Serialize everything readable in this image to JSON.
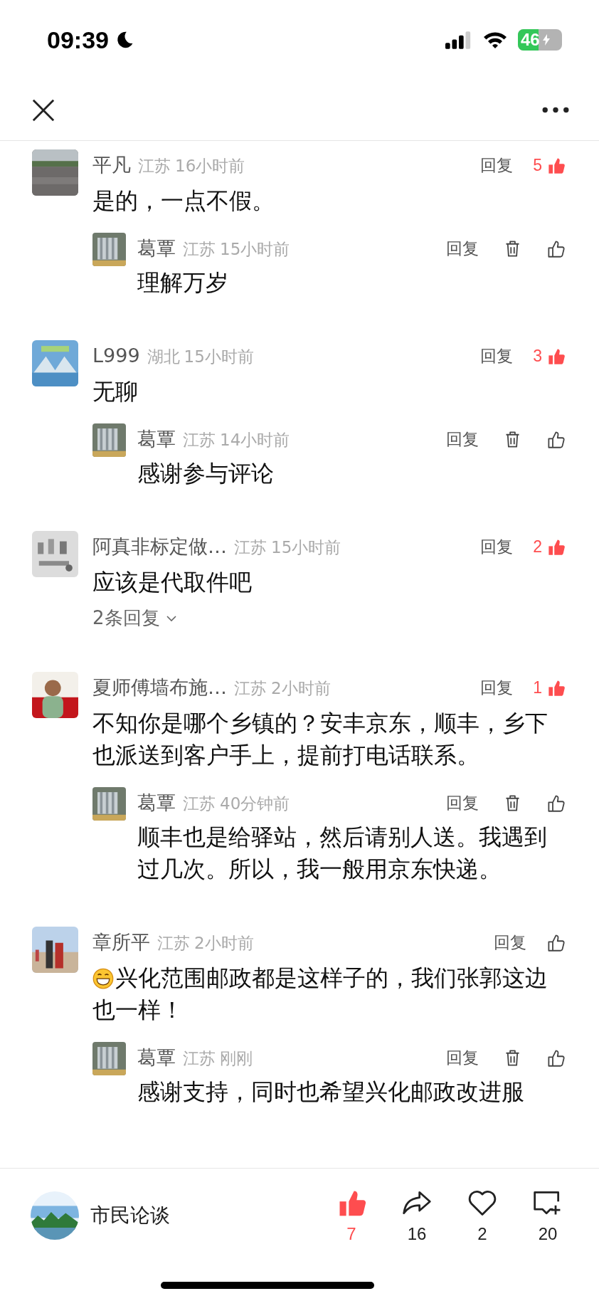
{
  "status_bar": {
    "time": "09:39",
    "battery": "46"
  },
  "comments": [
    {
      "name": "平凡",
      "region": "江苏",
      "time": "16小时前",
      "reply_label": "回复",
      "likes": "5",
      "liked": true,
      "text": "是的，一点不假。",
      "replies": [
        {
          "name": "葛覃",
          "region": "江苏",
          "time": "15小时前",
          "reply_label": "回复",
          "deletable": true,
          "liked": false,
          "text": "理解万岁"
        }
      ]
    },
    {
      "name": "L999",
      "region": "湖北",
      "time": "15小时前",
      "reply_label": "回复",
      "likes": "3",
      "liked": true,
      "text": "无聊",
      "replies": [
        {
          "name": "葛覃",
          "region": "江苏",
          "time": "14小时前",
          "reply_label": "回复",
          "deletable": true,
          "liked": false,
          "text": "感谢参与评论"
        }
      ]
    },
    {
      "name": "阿真非标定做…",
      "region": "江苏",
      "time": "15小时前",
      "reply_label": "回复",
      "likes": "2",
      "liked": true,
      "text": "应该是代取件吧",
      "more_replies": "2条回复"
    },
    {
      "name": "夏师傅墙布施…",
      "region": "江苏",
      "time": "2小时前",
      "reply_label": "回复",
      "likes": "1",
      "liked": true,
      "text": "不知你是哪个乡镇的？安丰京东，顺丰，乡下也派送到客户手上，提前打电话联系。",
      "replies": [
        {
          "name": "葛覃",
          "region": "江苏",
          "time": "40分钟前",
          "reply_label": "回复",
          "deletable": true,
          "liked": false,
          "text": "顺丰也是给驿站，然后请别人送。我遇到过几次。所以，我一般用京东快递。"
        }
      ]
    },
    {
      "name": "章所平",
      "region": "江苏",
      "time": "2小时前",
      "reply_label": "回复",
      "liked": false,
      "emoji_lead": true,
      "text": "兴化范围邮政都是这样子的，我们张郭这边也一样！",
      "replies": [
        {
          "name": "葛覃",
          "region": "江苏",
          "time": "刚刚",
          "reply_label": "回复",
          "deletable": true,
          "liked": false,
          "text": "感谢支持，同时也希望兴化邮政改进服"
        }
      ]
    }
  ],
  "bottom_bar": {
    "account": "市民论谈",
    "actions": [
      {
        "kind": "like",
        "count": "7",
        "active": true
      },
      {
        "kind": "share",
        "count": "16",
        "active": false
      },
      {
        "kind": "favorite",
        "count": "2",
        "active": false
      },
      {
        "kind": "comment",
        "count": "20",
        "active": false
      }
    ]
  }
}
